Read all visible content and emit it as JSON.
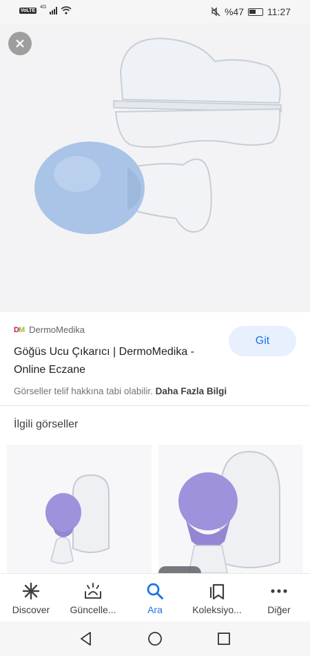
{
  "status_bar": {
    "volte": "VoLTE",
    "network": "4G",
    "battery_text": "%47",
    "time": "11:27"
  },
  "result": {
    "source_logo": "DM",
    "source_name": "DermoMedika",
    "title": "Göğüs Ucu Çıkarıcı | DermoMedika - Online Eczane",
    "visit_label": "Git",
    "copyright_text": "Görseller telif hakkına tabi olabilir.",
    "learn_more": "Daha Fazla Bilgi"
  },
  "related": {
    "heading": "İlgili görseller"
  },
  "bottom_nav": {
    "items": [
      {
        "label": "Discover",
        "icon": "asterisk-icon"
      },
      {
        "label": "Güncelle...",
        "icon": "updates-icon"
      },
      {
        "label": "Ara",
        "icon": "search-icon"
      },
      {
        "label": "Koleksiyo...",
        "icon": "bookmark-icon"
      },
      {
        "label": "Diğer",
        "icon": "more-dots-icon"
      }
    ],
    "active_index": 2
  },
  "system_nav": [
    "back-icon",
    "home-icon",
    "recents-icon"
  ],
  "colors": {
    "accent": "#1a73e8",
    "button_bg": "#e8f0fe",
    "product_blue": "#a9c4e6",
    "product_purple": "#9f92dc"
  }
}
